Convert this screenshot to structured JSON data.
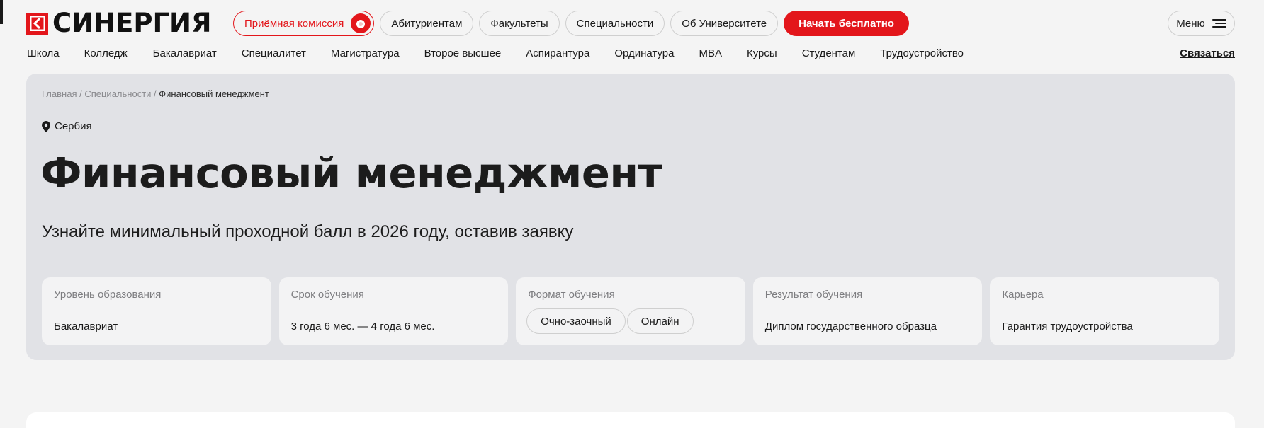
{
  "logo": {
    "text": "СИНЕРГИЯ"
  },
  "header": {
    "pills": [
      {
        "label": "Приёмная комиссия"
      },
      {
        "label": "Абитуриентам"
      },
      {
        "label": "Факультеты"
      },
      {
        "label": "Специальности"
      },
      {
        "label": "Об Университете"
      }
    ],
    "cta_label": "Начать бесплатно",
    "menu_label": "Меню"
  },
  "nav": {
    "items": [
      "Школа",
      "Колледж",
      "Бакалавриат",
      "Специалитет",
      "Магистратура",
      "Второе высшее",
      "Аспирантура",
      "Ординатура",
      "MBA",
      "Курсы",
      "Студентам",
      "Трудоустройство"
    ],
    "contact": "Связаться"
  },
  "breadcrumb": {
    "home": "Главная",
    "sep1": " / ",
    "section": "Специальности",
    "sep2": " / ",
    "current": "Финансовый менеджмент"
  },
  "location": "Сербия",
  "title": "Финансовый менеджмент",
  "subtitle": "Узнайте минимальный проходной балл в 2026 году, оставив заявку",
  "info": {
    "level": {
      "label": "Уровень образования",
      "value": "Бакалавриат"
    },
    "duration": {
      "label": "Срок обучения",
      "value": "3 года 6 мес. — 4 года 6 мес."
    },
    "format": {
      "label": "Формат обучения",
      "tags": [
        "Очно-заочный",
        "Онлайн"
      ]
    },
    "result": {
      "label": "Результат обучения",
      "value": "Диплом государственного образца"
    },
    "career": {
      "label": "Карьера",
      "value": "Гарантия трудоустройства"
    }
  },
  "colors": {
    "brand": "#e3161b",
    "hero_bg": "#e1e2e6",
    "card_bg": "#f3f3f4"
  }
}
